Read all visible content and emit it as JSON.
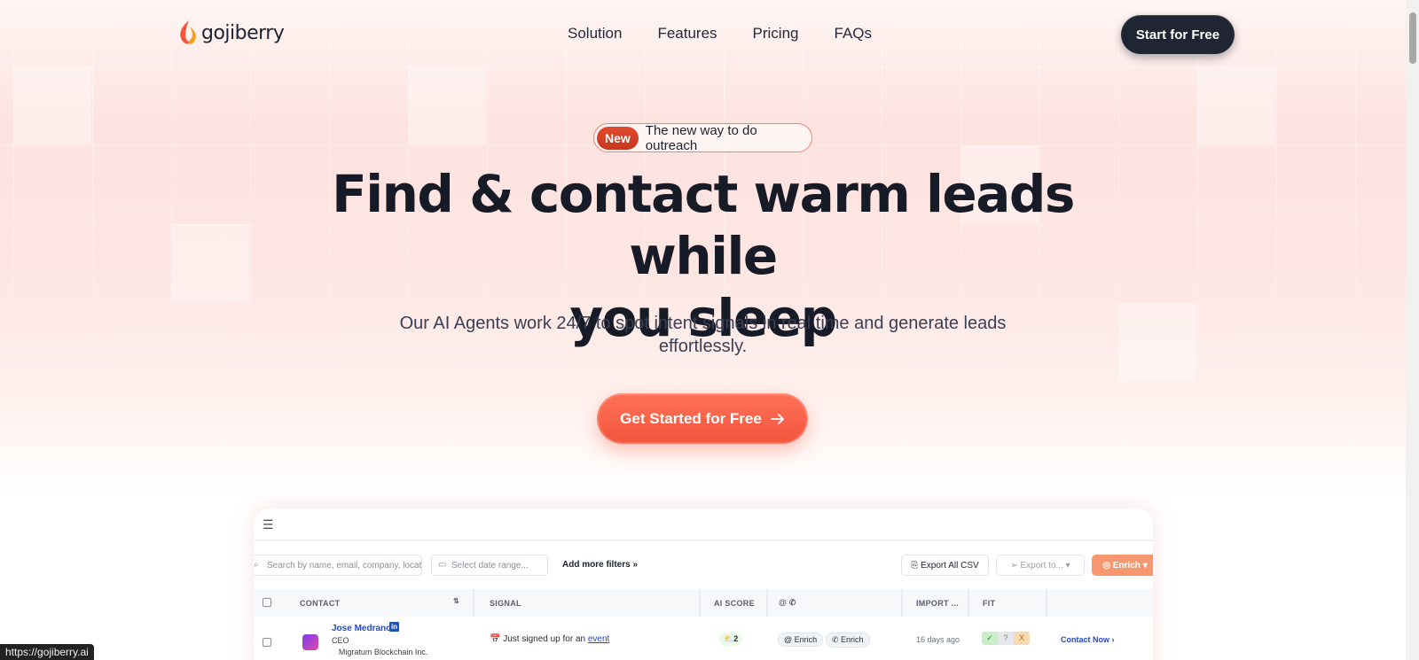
{
  "brand": {
    "name": "gojiberry"
  },
  "nav": {
    "items": [
      "Solution",
      "Features",
      "Pricing",
      "FAQs"
    ]
  },
  "header": {
    "cta": "Start for Free"
  },
  "hero": {
    "badge_label": "New",
    "badge_text": "The new way to do outreach",
    "headline_line1": "Find & contact warm leads while",
    "headline_line2": "you sleep",
    "subhead": "Our AI Agents work 24/7 to spot intent signals in real time and generate leads effortlessly.",
    "cta": "Get Started for Free"
  },
  "app": {
    "search_placeholder": "Search by name, email, company, locat",
    "date_placeholder": "Select date range...",
    "more_filters": "Add more filters",
    "export_csv": "Export All CSV",
    "export_to": "Export to...",
    "enrich": "Enrich",
    "columns": {
      "contact": "CONTACT",
      "signal": "SIGNAL",
      "score": "AI SCORE",
      "import": "IMPORT ...",
      "fit": "FIT"
    },
    "row": {
      "name": "Jose Medrano",
      "title": "CEO",
      "company": "Migratum Blockchain Inc.",
      "signal_text": "Just signed up for an",
      "signal_link": "event",
      "score": "2",
      "enrich_email": "Enrich",
      "enrich_phone": "Enrich",
      "imported": "16 days ago",
      "fit": [
        "✓",
        "?",
        "X"
      ],
      "action": "Contact Now"
    }
  },
  "status_bar": {
    "url": "https://gojiberry.ai"
  },
  "colors": {
    "accent": "#f2553c",
    "dark": "#1f2532",
    "link": "#2548c9"
  }
}
